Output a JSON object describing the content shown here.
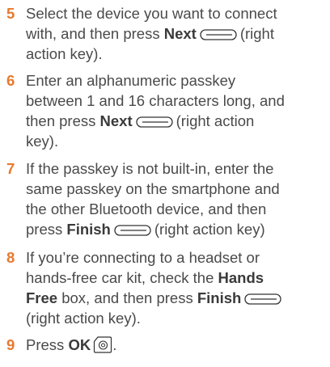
{
  "steps": [
    {
      "number": "5",
      "l1": "Select the device you want to connect",
      "l2a": "with, and then press ",
      "l2b": "Next",
      "l2c": "(right",
      "l3": "action key)."
    },
    {
      "number": "6",
      "l1": "Enter an alphanumeric passkey",
      "l2": "between 1 and 16 characters long, and",
      "l3a": "then press ",
      "l3b": "Next",
      "l3c": "(right action",
      "l4": "key)."
    },
    {
      "number": "7",
      "l1": "If the passkey is not built-in, enter the",
      "l2": "same passkey on the smartphone and",
      "l3": "the other Bluetooth device, and then",
      "l4a": "press ",
      "l4b": "Finish",
      "l4c": "(right action key)"
    },
    {
      "number": "8",
      "l1": "If you’re connecting to a headset or",
      "l2a": "hands-free car kit, check the ",
      "l2b": "Hands",
      "l3a": "Free",
      "l3b": " box, and then press ",
      "l3c": "Finish",
      "l4": "(right action key)."
    },
    {
      "number": "9",
      "l1a": "Press ",
      "l1b": "OK"
    }
  ],
  "icons": {
    "right_action_key": "right-action-key-icon",
    "ok_key": "ok-key-icon"
  },
  "colors": {
    "step_number": "#e8792e",
    "body_text": "#4a4a4a"
  }
}
